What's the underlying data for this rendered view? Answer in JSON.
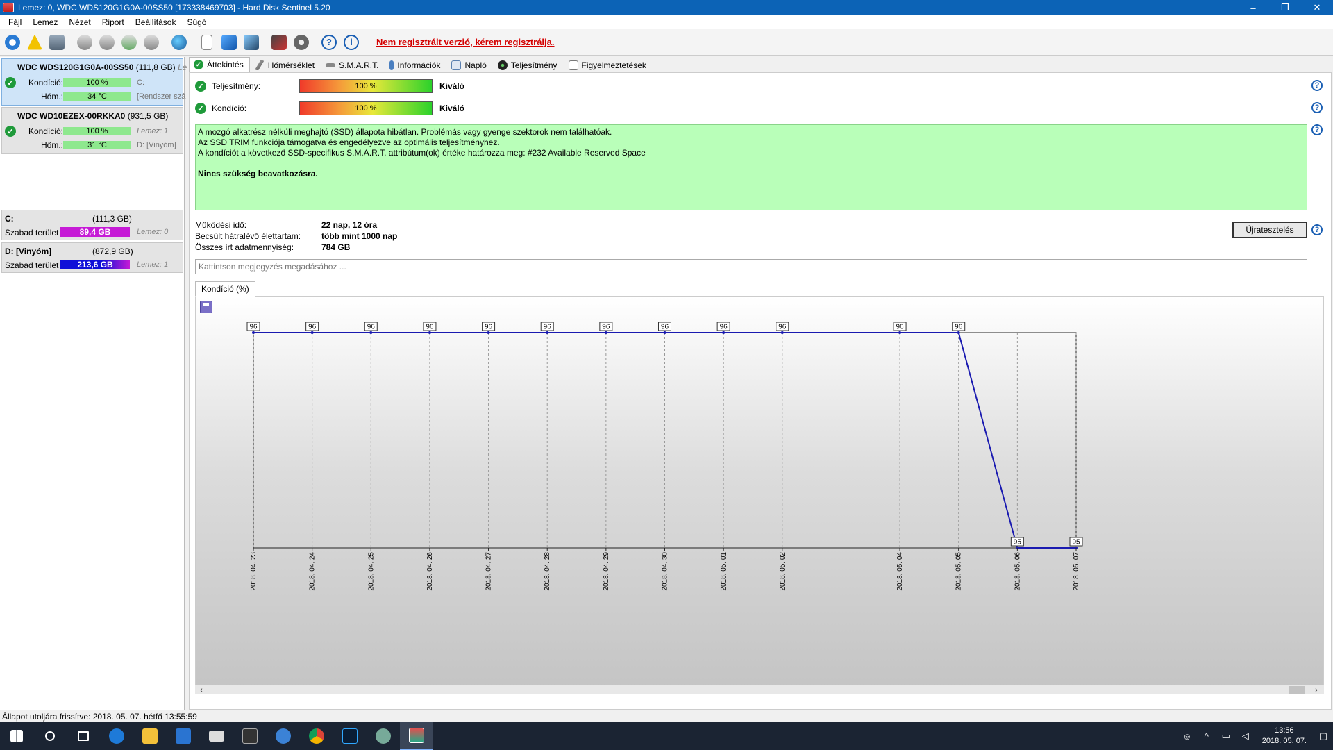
{
  "window": {
    "title": "Lemez: 0, WDC WDS120G1G0A-00SS50 [173338469703] - Hard Disk Sentinel 5.20",
    "minimize": "–",
    "restore": "❐",
    "close": "✕"
  },
  "menu": [
    "Fájl",
    "Lemez",
    "Nézet",
    "Riport",
    "Beállítások",
    "Súgó"
  ],
  "toolbar": {
    "unregistered": "Nem regisztrált verzió, kérem regisztrálja.",
    "help_glyph": "?",
    "info_glyph": "i"
  },
  "disks": [
    {
      "name": "WDC WDS120G1G0A-00SS50",
      "capacity": "(111,8 GB)",
      "extra": "Le",
      "condition_label": "Kondíció:",
      "condition": "100 %",
      "condition_side": "C:",
      "temp_label": "Hőm.:",
      "temp": "34 °C",
      "temp_side": "[Rendszer szá"
    },
    {
      "name": "WDC WD10EZEX-00RKKA0",
      "capacity": "(931,5 GB)",
      "condition_label": "Kondíció:",
      "condition": "100 %",
      "condition_side": "Lemez: 1",
      "temp_label": "Hőm.:",
      "temp": "31 °C",
      "temp_side": "D: [Vinyóm]"
    }
  ],
  "volumes": [
    {
      "name": "C:",
      "capacity": "(111,3 GB)",
      "free_label": "Szabad terület",
      "free": "89,4 GB",
      "disk": "Lemez: 0",
      "color": "#c61bd6"
    },
    {
      "name": "D: [Vinyóm]",
      "capacity": "(872,9 GB)",
      "free_label": "Szabad terület",
      "free": "213,6 GB",
      "disk": "Lemez: 1",
      "color": "#1010d8"
    }
  ],
  "tabs": [
    "Áttekintés",
    "Hőmérséklet",
    "S.M.A.R.T.",
    "Információk",
    "Napló",
    "Teljesítmény",
    "Figyelmeztetések"
  ],
  "overview": {
    "performance_label": "Teljesítmény:",
    "performance_value": "100 %",
    "performance_text": "Kiváló",
    "performance_level": 100,
    "condition_label": "Kondíció:",
    "condition_value": "100 %",
    "condition_text": "Kiváló",
    "condition_level": 100,
    "status_lines": [
      "A mozgó alkatrész nélküli meghajtó (SSD) állapota hibátlan. Problémás vagy gyenge szektorok nem találhatóak.",
      "Az SSD TRIM funkciója támogatva és engedélyezve az optimális teljesítményhez.",
      "A kondíciót a következő SSD-specifikus S.M.A.R.T. attribútum(ok) értéke határozza meg:  #232 Available Reserved Space"
    ],
    "status_action": "Nincs szükség beavatkozásra.",
    "uptime_label": "Működési idő:",
    "uptime": "22 nap, 12 óra",
    "lifetime_label": "Becsült hátralévő élettartam:",
    "lifetime": "több mint 1000 nap",
    "written_label": "Összes írt adatmennyiség:",
    "written": "784 GB",
    "retest_button": "Újratesztelés",
    "note_placeholder": "Kattintson megjegyzés megadásához ...",
    "chart_tab": "Kondíció  (%)"
  },
  "chart_data": {
    "type": "line",
    "title": "Kondíció  (%)",
    "x": [
      "2018. 04. 23",
      "2018. 04. 24",
      "2018. 04. 25",
      "2018. 04. 26",
      "2018. 04. 27",
      "2018. 04. 28",
      "2018. 04. 29",
      "2018. 04. 30",
      "2018. 05. 01",
      "2018. 05. 02",
      "2018. 05. 04",
      "2018. 05. 05",
      "2018. 05. 06",
      "2018. 05. 07"
    ],
    "day_index": [
      0,
      1,
      2,
      3,
      4,
      5,
      6,
      7,
      8,
      9,
      11,
      12,
      13,
      14
    ],
    "series": [
      {
        "values": [
          96,
          96,
          96,
          96,
          96,
          96,
          96,
          96,
          96,
          96,
          96,
          96,
          95,
          95
        ]
      }
    ],
    "ylim": [
      95,
      96
    ],
    "grid": true,
    "line_color": "#1a1ab0"
  },
  "statusbar": "Állapot utoljára frissítve: 2018. 05. 07. hétfő 13:55:59",
  "clock": {
    "time": "13:56",
    "date": "2018. 05. 07."
  }
}
